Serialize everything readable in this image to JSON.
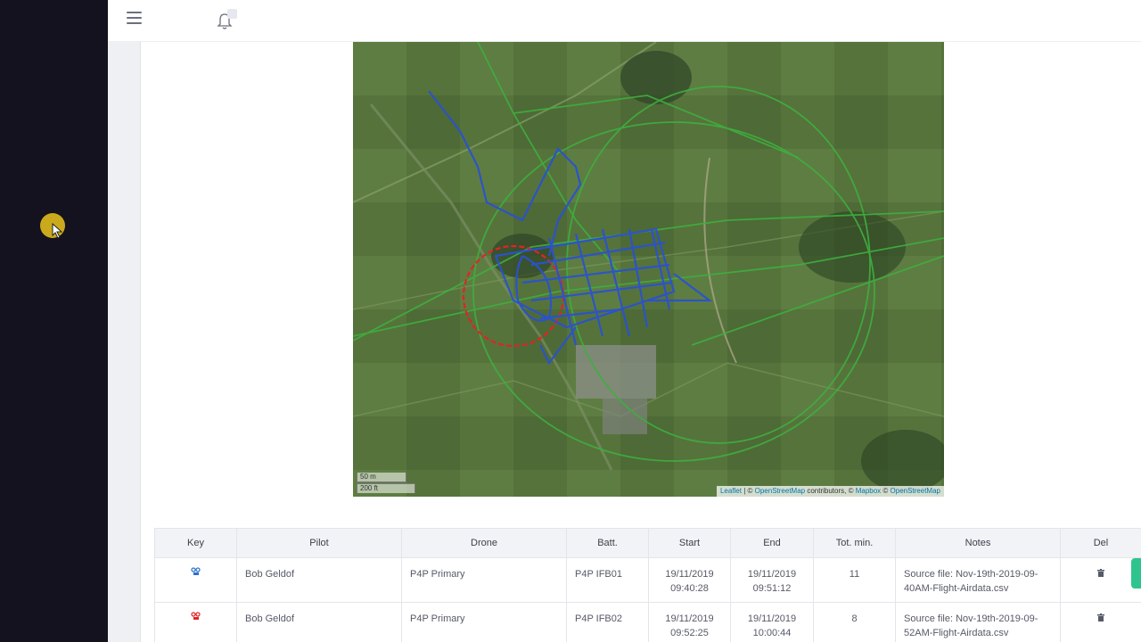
{
  "topbar": {
    "menu_icon": "hamburger-icon",
    "notification_icon": "bell-icon"
  },
  "map": {
    "scale_metric": "50 m",
    "scale_imperial": "200 ft",
    "attribution": {
      "leaflet": "Leaflet",
      "sep1": " | © ",
      "osm1": "OpenStreetMap",
      "mid": " contributors, © ",
      "mapbox": "Mapbox",
      "sep2": " © ",
      "osm2": "OpenStreetMap"
    },
    "track_colors": {
      "flight_1": "#2a52d0",
      "flight_2": "#e02424",
      "flight_3": "#3fae3f"
    }
  },
  "table": {
    "headers": [
      "Key",
      "Pilot",
      "Drone",
      "Batt.",
      "Start",
      "End",
      "Tot. min.",
      "Notes",
      "Del"
    ],
    "rows": [
      {
        "key_color": "#2a6fd0",
        "pilot": "Bob Geldof",
        "drone": "P4P Primary",
        "battery": "P4P IFB01",
        "start_date": "19/11/2019",
        "start_time": "09:40:28",
        "end_date": "19/11/2019",
        "end_time": "09:51:12",
        "total_min": "11",
        "notes_line1": "Source file: Nov-19th-2019-09-",
        "notes_line2": "40AM-Flight-Airdata.csv"
      },
      {
        "key_color": "#e02424",
        "pilot": "Bob Geldof",
        "drone": "P4P Primary",
        "battery": "P4P IFB02",
        "start_date": "19/11/2019",
        "start_time": "09:52:25",
        "end_date": "19/11/2019",
        "end_time": "10:00:44",
        "total_min": "8",
        "notes_line1": "Source file: Nov-19th-2019-09-",
        "notes_line2": "52AM-Flight-Airdata.csv"
      }
    ]
  }
}
